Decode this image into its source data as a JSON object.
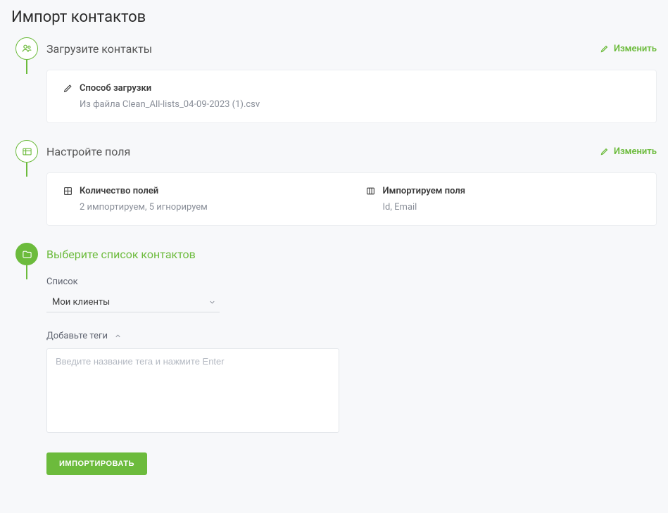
{
  "page_title": "Импорт контактов",
  "steps": {
    "upload": {
      "title": "Загрузите контакты",
      "change": "Изменить",
      "method_label": "Способ загрузки",
      "method_value": "Из файла Clean_All-lists_04-09-2023 (1).csv"
    },
    "fields": {
      "title": "Настройте поля",
      "change": "Изменить",
      "count_label": "Количество полей",
      "count_value": "2 импортируем, 5 игнорируем",
      "import_label": "Импортируем поля",
      "import_value": "Id, Email"
    },
    "list": {
      "title": "Выберите список контактов",
      "list_label": "Список",
      "list_value": "Мои клиенты",
      "tags_label": "Добавьте теги",
      "tags_placeholder": "Введите название тега и нажмите Enter",
      "submit": "ИМПОРТИРОВАТЬ"
    }
  }
}
